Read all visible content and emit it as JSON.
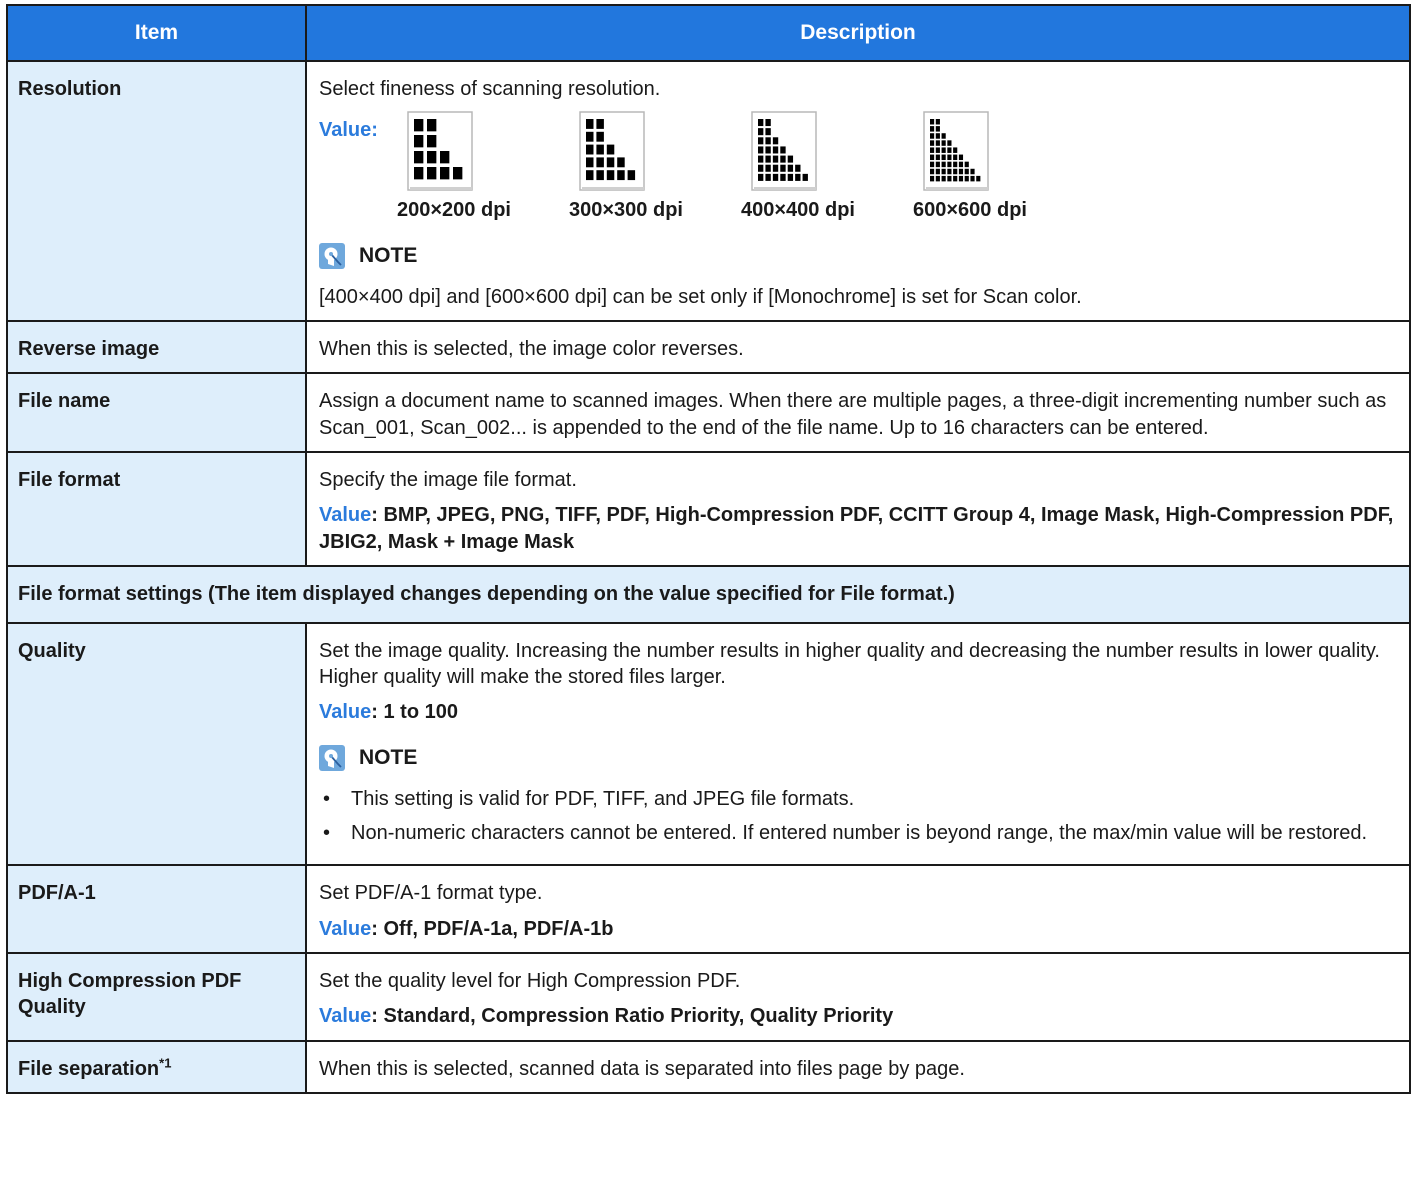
{
  "header": {
    "item": "Item",
    "description": "Description"
  },
  "resolution": {
    "label": "Resolution",
    "text": "Select fineness of scanning resolution.",
    "value_label": "Value",
    "options": [
      "200×200 dpi",
      "300×300 dpi",
      "400×400 dpi",
      "600×600 dpi"
    ],
    "note_title": "NOTE",
    "note_text": "[400×400 dpi] and [600×600 dpi] can be set only if [Monochrome] is set for Scan color."
  },
  "reverse_image": {
    "label": "Reverse image",
    "text": "When this is selected, the image color reverses."
  },
  "file_name": {
    "label": "File name",
    "text": "Assign a document name to scanned images. When there are multiple pages, a three-digit incrementing number such as Scan_001, Scan_002... is appended to the end of the file name. Up to 16 characters can be entered."
  },
  "file_format": {
    "label": "File format",
    "text": "Specify the image file format.",
    "value_label": "Value",
    "values": ": BMP, JPEG, PNG, TIFF, PDF, High-Compression PDF, CCITT Group 4, Image Mask, High-Compression PDF, JBIG2, Mask + Image Mask"
  },
  "section": {
    "text": "File format settings (The item displayed changes depending on the value specified for File format.)"
  },
  "quality": {
    "label": "Quality",
    "text": "Set the image quality. Increasing the number results in higher quality and decreasing the number results in lower quality. Higher quality will make the stored files larger.",
    "value_label": "Value",
    "values": ": 1 to 100",
    "note_title": "NOTE",
    "bullets": [
      "This setting is valid for PDF, TIFF, and JPEG file formats.",
      "Non-numeric characters cannot be entered. If entered number is beyond range, the max/min value will be restored."
    ]
  },
  "pdfa1": {
    "label": "PDF/A-1",
    "text": "Set PDF/A-1 format type.",
    "value_label": "Value",
    "values": ": Off, PDF/A-1a, PDF/A-1b"
  },
  "hc_pdf_quality": {
    "label": "High Compression PDF Quality",
    "text": "Set the quality level for High Compression PDF.",
    "value_label": "Value",
    "values": ": Standard, Compression Ratio Priority, Quality Priority"
  },
  "file_separation": {
    "label": "File separation",
    "footnote": "*1",
    "text": "When this is selected, scanned data is separated into files page by page."
  },
  "colors": {
    "header_bg": "#2277dd",
    "item_bg": "#deeefb",
    "value_label": "#2b7bdc"
  },
  "icons": {
    "note": "note-icon",
    "resolution": "resolution-pattern-icon"
  }
}
